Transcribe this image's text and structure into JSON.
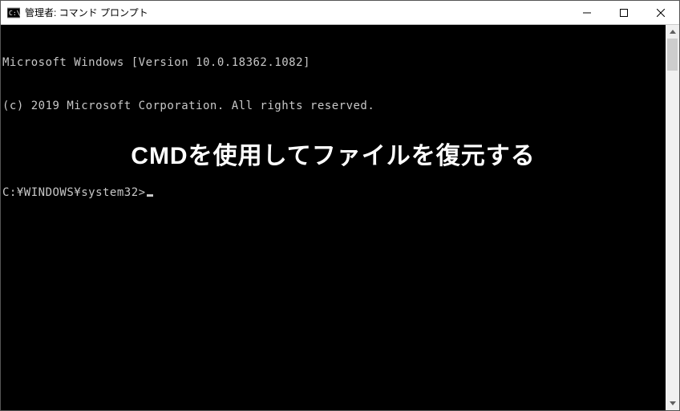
{
  "window": {
    "title": "管理者: コマンド プロンプト"
  },
  "console": {
    "line1": "Microsoft Windows [Version 10.0.18362.1082]",
    "line2": "(c) 2019 Microsoft Corporation. All rights reserved.",
    "prompt": "C:¥WINDOWS¥system32>"
  },
  "overlay": {
    "text": "CMDを使用してファイルを復元する"
  }
}
